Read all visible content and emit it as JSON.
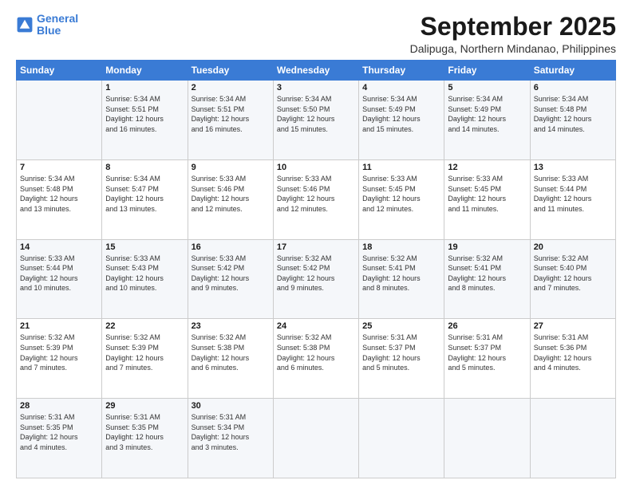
{
  "logo": {
    "line1": "General",
    "line2": "Blue"
  },
  "header": {
    "month": "September 2025",
    "location": "Dalipuga, Northern Mindanao, Philippines"
  },
  "weekdays": [
    "Sunday",
    "Monday",
    "Tuesday",
    "Wednesday",
    "Thursday",
    "Friday",
    "Saturday"
  ],
  "weeks": [
    [
      {
        "day": "",
        "info": ""
      },
      {
        "day": "1",
        "info": "Sunrise: 5:34 AM\nSunset: 5:51 PM\nDaylight: 12 hours\nand 16 minutes."
      },
      {
        "day": "2",
        "info": "Sunrise: 5:34 AM\nSunset: 5:51 PM\nDaylight: 12 hours\nand 16 minutes."
      },
      {
        "day": "3",
        "info": "Sunrise: 5:34 AM\nSunset: 5:50 PM\nDaylight: 12 hours\nand 15 minutes."
      },
      {
        "day": "4",
        "info": "Sunrise: 5:34 AM\nSunset: 5:49 PM\nDaylight: 12 hours\nand 15 minutes."
      },
      {
        "day": "5",
        "info": "Sunrise: 5:34 AM\nSunset: 5:49 PM\nDaylight: 12 hours\nand 14 minutes."
      },
      {
        "day": "6",
        "info": "Sunrise: 5:34 AM\nSunset: 5:48 PM\nDaylight: 12 hours\nand 14 minutes."
      }
    ],
    [
      {
        "day": "7",
        "info": "Sunrise: 5:34 AM\nSunset: 5:48 PM\nDaylight: 12 hours\nand 13 minutes."
      },
      {
        "day": "8",
        "info": "Sunrise: 5:34 AM\nSunset: 5:47 PM\nDaylight: 12 hours\nand 13 minutes."
      },
      {
        "day": "9",
        "info": "Sunrise: 5:33 AM\nSunset: 5:46 PM\nDaylight: 12 hours\nand 12 minutes."
      },
      {
        "day": "10",
        "info": "Sunrise: 5:33 AM\nSunset: 5:46 PM\nDaylight: 12 hours\nand 12 minutes."
      },
      {
        "day": "11",
        "info": "Sunrise: 5:33 AM\nSunset: 5:45 PM\nDaylight: 12 hours\nand 12 minutes."
      },
      {
        "day": "12",
        "info": "Sunrise: 5:33 AM\nSunset: 5:45 PM\nDaylight: 12 hours\nand 11 minutes."
      },
      {
        "day": "13",
        "info": "Sunrise: 5:33 AM\nSunset: 5:44 PM\nDaylight: 12 hours\nand 11 minutes."
      }
    ],
    [
      {
        "day": "14",
        "info": "Sunrise: 5:33 AM\nSunset: 5:44 PM\nDaylight: 12 hours\nand 10 minutes."
      },
      {
        "day": "15",
        "info": "Sunrise: 5:33 AM\nSunset: 5:43 PM\nDaylight: 12 hours\nand 10 minutes."
      },
      {
        "day": "16",
        "info": "Sunrise: 5:33 AM\nSunset: 5:42 PM\nDaylight: 12 hours\nand 9 minutes."
      },
      {
        "day": "17",
        "info": "Sunrise: 5:32 AM\nSunset: 5:42 PM\nDaylight: 12 hours\nand 9 minutes."
      },
      {
        "day": "18",
        "info": "Sunrise: 5:32 AM\nSunset: 5:41 PM\nDaylight: 12 hours\nand 8 minutes."
      },
      {
        "day": "19",
        "info": "Sunrise: 5:32 AM\nSunset: 5:41 PM\nDaylight: 12 hours\nand 8 minutes."
      },
      {
        "day": "20",
        "info": "Sunrise: 5:32 AM\nSunset: 5:40 PM\nDaylight: 12 hours\nand 7 minutes."
      }
    ],
    [
      {
        "day": "21",
        "info": "Sunrise: 5:32 AM\nSunset: 5:39 PM\nDaylight: 12 hours\nand 7 minutes."
      },
      {
        "day": "22",
        "info": "Sunrise: 5:32 AM\nSunset: 5:39 PM\nDaylight: 12 hours\nand 7 minutes."
      },
      {
        "day": "23",
        "info": "Sunrise: 5:32 AM\nSunset: 5:38 PM\nDaylight: 12 hours\nand 6 minutes."
      },
      {
        "day": "24",
        "info": "Sunrise: 5:32 AM\nSunset: 5:38 PM\nDaylight: 12 hours\nand 6 minutes."
      },
      {
        "day": "25",
        "info": "Sunrise: 5:31 AM\nSunset: 5:37 PM\nDaylight: 12 hours\nand 5 minutes."
      },
      {
        "day": "26",
        "info": "Sunrise: 5:31 AM\nSunset: 5:37 PM\nDaylight: 12 hours\nand 5 minutes."
      },
      {
        "day": "27",
        "info": "Sunrise: 5:31 AM\nSunset: 5:36 PM\nDaylight: 12 hours\nand 4 minutes."
      }
    ],
    [
      {
        "day": "28",
        "info": "Sunrise: 5:31 AM\nSunset: 5:35 PM\nDaylight: 12 hours\nand 4 minutes."
      },
      {
        "day": "29",
        "info": "Sunrise: 5:31 AM\nSunset: 5:35 PM\nDaylight: 12 hours\nand 3 minutes."
      },
      {
        "day": "30",
        "info": "Sunrise: 5:31 AM\nSunset: 5:34 PM\nDaylight: 12 hours\nand 3 minutes."
      },
      {
        "day": "",
        "info": ""
      },
      {
        "day": "",
        "info": ""
      },
      {
        "day": "",
        "info": ""
      },
      {
        "day": "",
        "info": ""
      }
    ]
  ]
}
